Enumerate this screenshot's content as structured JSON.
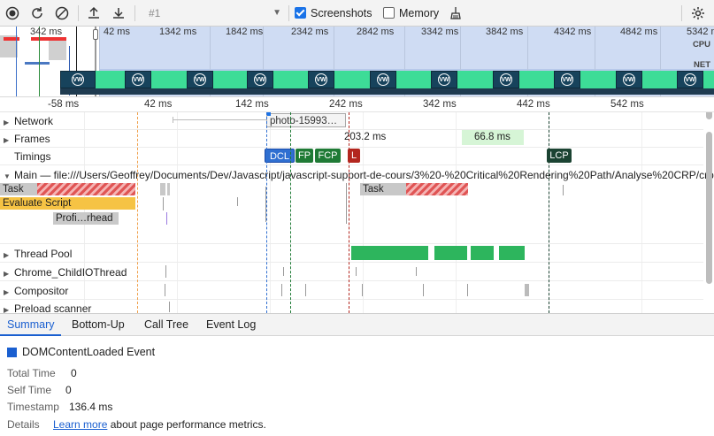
{
  "toolbar": {
    "record_icon": "record-icon",
    "reload_icon": "reload-icon",
    "clear_icon": "clear-icon",
    "upload_icon": "upload-icon",
    "download_icon": "download-icon",
    "profile_select": "#1",
    "screenshots_label": "Screenshots",
    "screenshots_checked": true,
    "memory_label": "Memory",
    "memory_checked": false,
    "gc_icon": "broom-icon",
    "settings_icon": "gear-icon"
  },
  "overview": {
    "left_time": "342 ms",
    "ticks": [
      "42 ms",
      "1342 ms",
      "1842 ms",
      "2342 ms",
      "2842 ms",
      "3342 ms",
      "3842 ms",
      "4342 ms",
      "4842 ms",
      "5342 ms"
    ],
    "cpu_label": "CPU",
    "net_label": "NET",
    "frame_icon": "vw-logo-icon"
  },
  "ruler": [
    "-58 ms",
    "42 ms",
    "142 ms",
    "242 ms",
    "342 ms",
    "442 ms",
    "542 ms"
  ],
  "tracks": {
    "network": {
      "title": "Network",
      "request_label": "photo-15993…"
    },
    "frames": {
      "title": "Frames",
      "frame1": "203.2 ms",
      "frame2": "66.8 ms"
    },
    "timings": {
      "title": "Timings",
      "dcl": "DCL",
      "fp": "FP",
      "fcp": "FCP",
      "l": "L",
      "lcp": "LCP"
    },
    "main": {
      "title": "Main — file:///Users/Geoffrey/Documents/Dev/Javascript/javascript-support-de-cours/3%20-%20Critical%20Rendering%20Path/Analyse%20CRP/crp",
      "task1": "Task",
      "evaluate": "Evaluate Script",
      "profile": "Profi…rhead",
      "task2": "Task"
    },
    "thread_pool": {
      "title": "Thread Pool"
    },
    "io_thread": {
      "title": "Chrome_ChildIOThread"
    },
    "compositor": {
      "title": "Compositor"
    },
    "preload": {
      "title": "Preload scanner"
    }
  },
  "tabs": [
    "Summary",
    "Bottom-Up",
    "Call Tree",
    "Event Log"
  ],
  "summary": {
    "title": "DOMContentLoaded Event",
    "total_time_label": "Total Time",
    "total_time_value": "0",
    "self_time_label": "Self Time",
    "self_time_value": "0",
    "timestamp_label": "Timestamp",
    "timestamp_value": "136.4 ms",
    "details_label": "Details",
    "details_link": "Learn more",
    "details_text": "about page performance metrics."
  },
  "colors": {
    "accent": "#1a5fd0",
    "dcl": "#2f6fd1",
    "fp": "#1f7a35",
    "fcp": "#1f7a35",
    "l": "#b3261e",
    "lcp": "#1b4332",
    "task": "#c8c8c8",
    "evaluate": "#f6c344",
    "profile": "#c9c9c9",
    "thread_pool": "#2db55d",
    "frame_green": "#d6f5d6"
  }
}
